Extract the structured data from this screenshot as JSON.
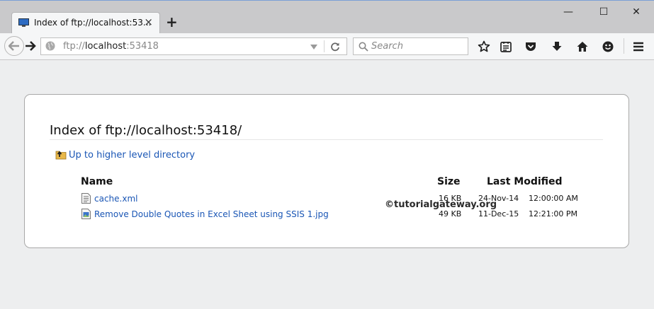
{
  "browser": {
    "tab_title": "Index of ftp://localhost:53...",
    "new_tab": "+",
    "window_controls": {
      "minimize": "—",
      "maximize": "☐",
      "close": "✕"
    },
    "url_scheme": "ftp://",
    "url_host": "localhost",
    "url_port": ":53418",
    "search_placeholder": "Search",
    "toolbar_icons": [
      "star-icon",
      "reading-list-icon",
      "pocket-icon",
      "download-icon",
      "home-icon",
      "hello-icon",
      "menu-icon"
    ],
    "accent_color": "#1a56b5"
  },
  "page": {
    "title": "Index of ftp://localhost:53418/",
    "up_link": "Up to higher level directory",
    "columns": {
      "name": "Name",
      "size": "Size",
      "modified": "Last Modified"
    },
    "files": [
      {
        "name": "cache.xml",
        "icon": "xml-file-icon",
        "size": "16 KB",
        "date": "24-Nov-14",
        "time": "12:00:00 AM"
      },
      {
        "name": "Remove Double Quotes in Excel Sheet using SSIS 1.jpg",
        "icon": "image-file-icon",
        "size": "49 KB",
        "date": "11-Dec-15",
        "time": "12:21:00 PM"
      }
    ],
    "watermark": "©tutorialgateway.org"
  }
}
